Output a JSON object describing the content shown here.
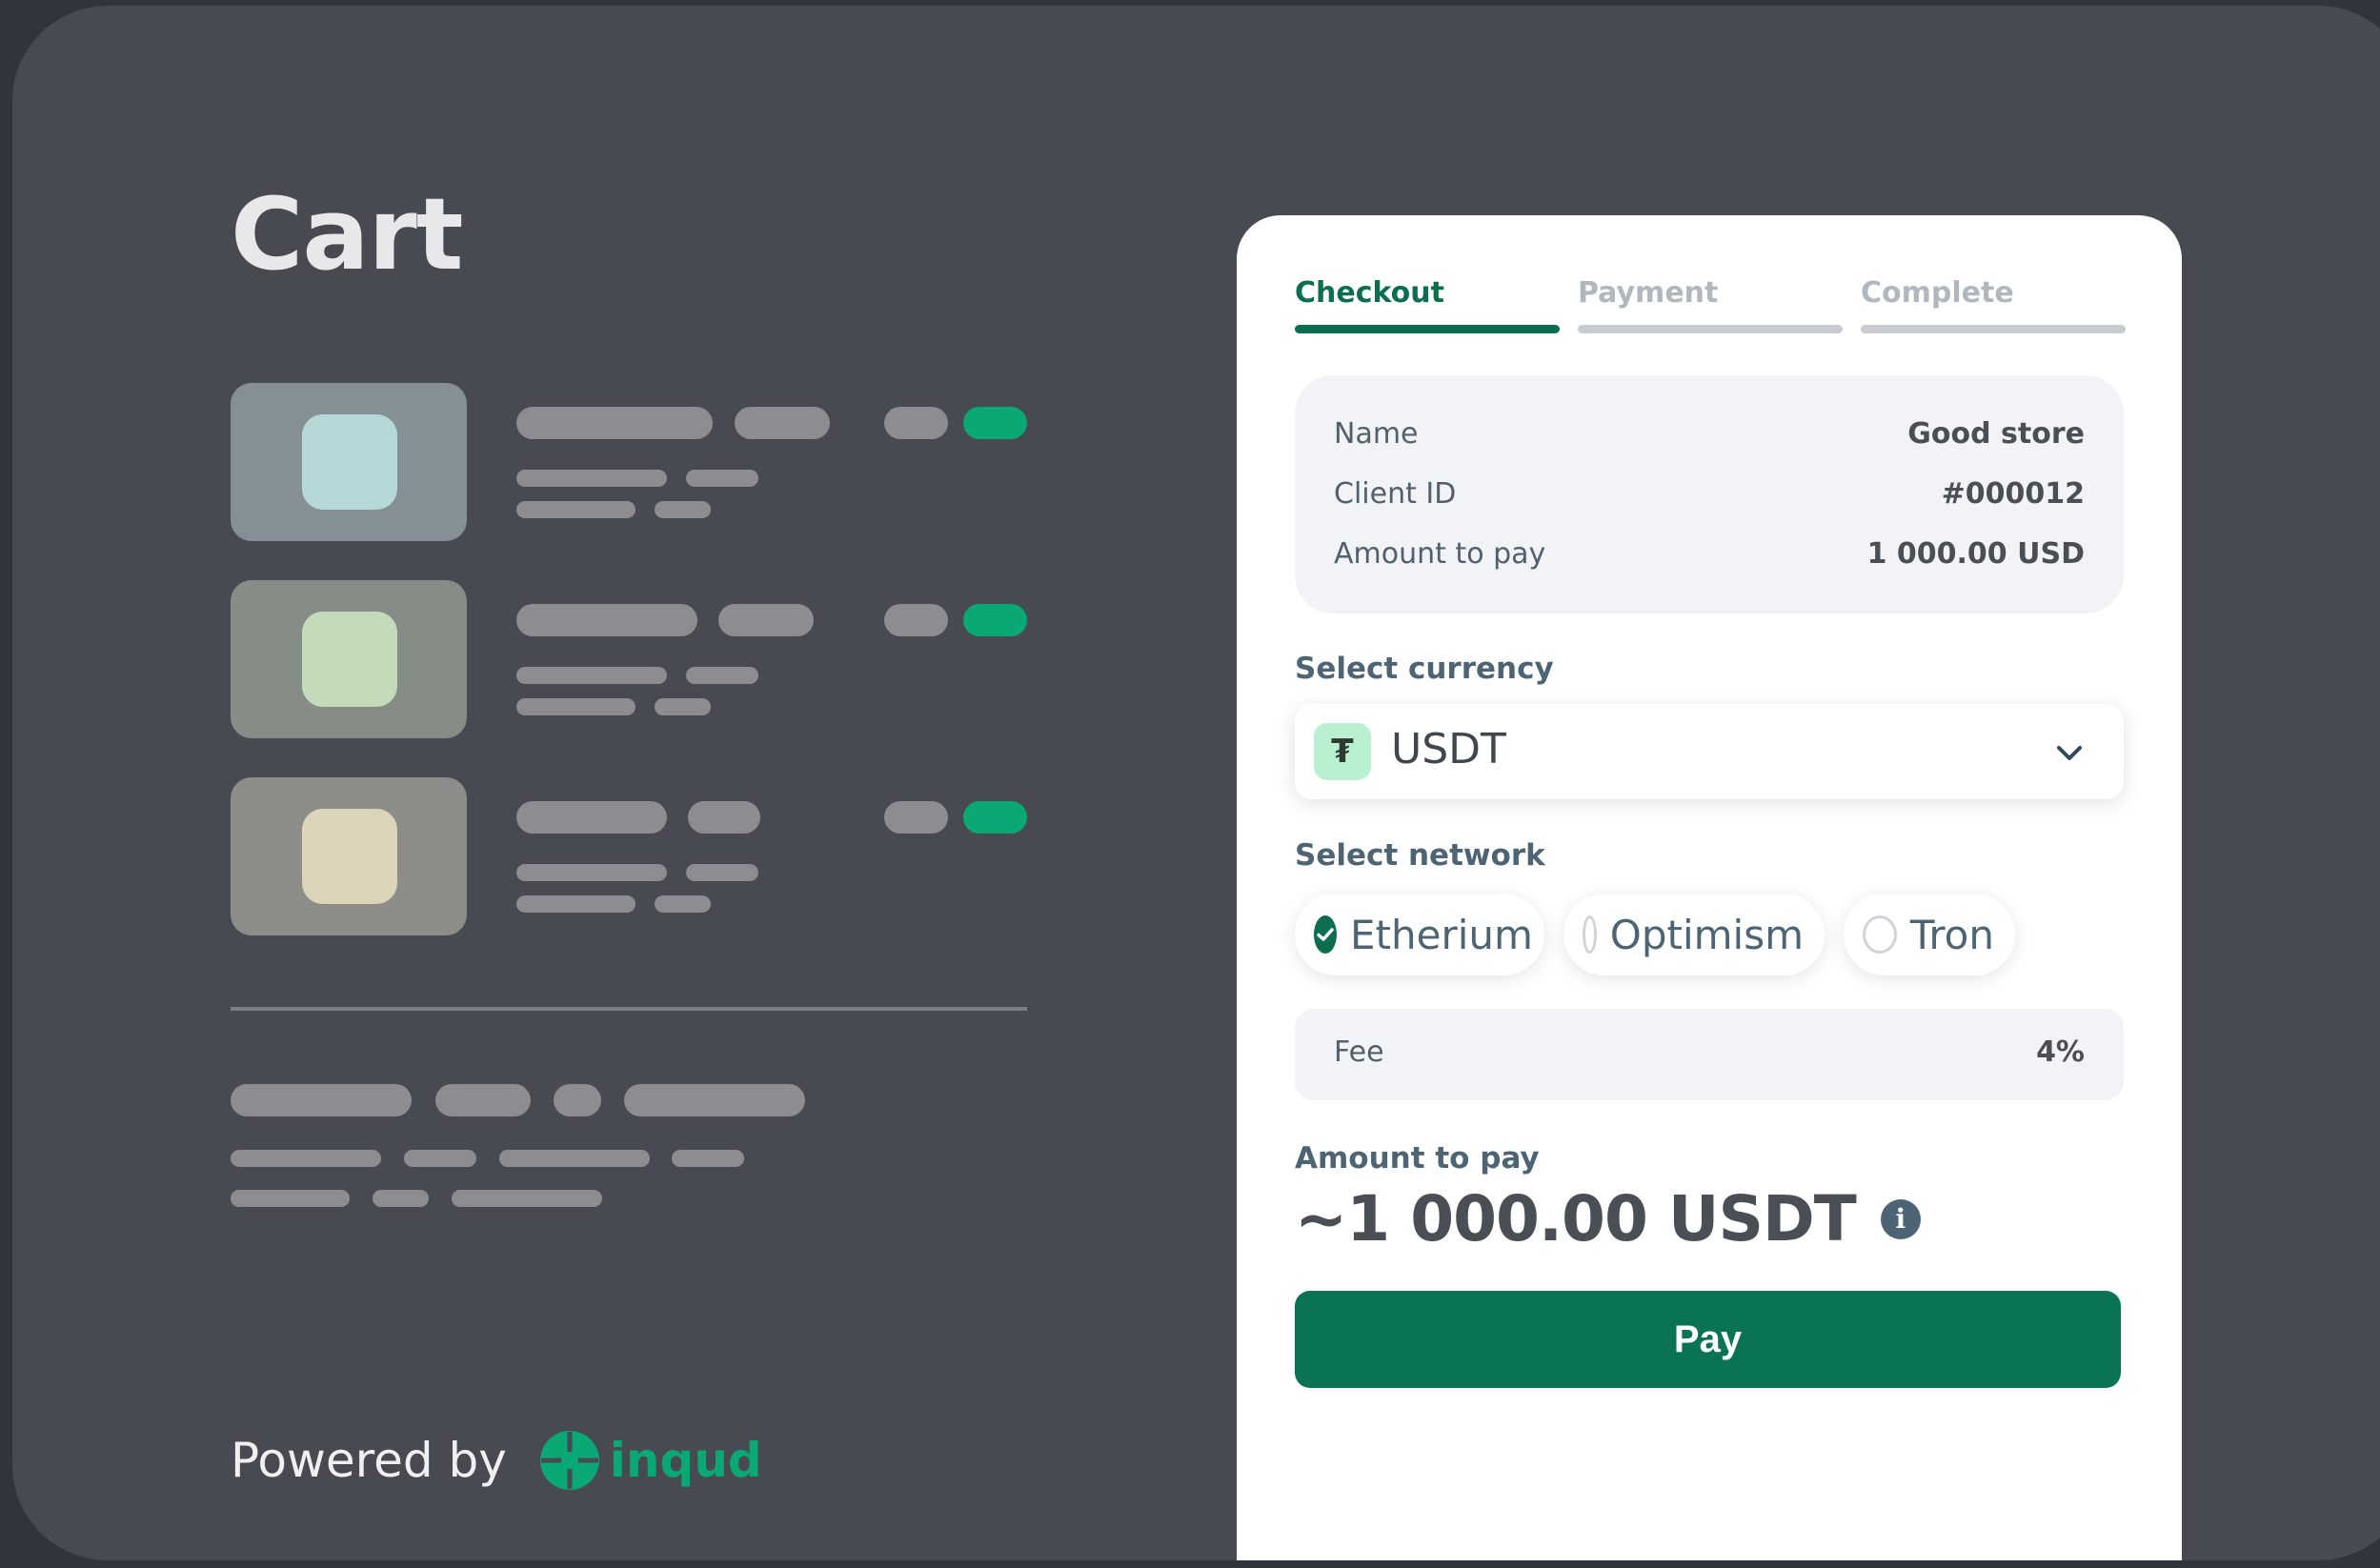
{
  "cart": {
    "title": "Cart",
    "thumb_colors": [
      "#849096",
      "#868d87",
      "#8c8d88"
    ],
    "thumb_inner_colors": [
      "#b7d8d9",
      "#c3dbbb",
      "#dcd4b8"
    ]
  },
  "footer": {
    "powered_by": "Powered by",
    "brand": "inqud"
  },
  "steps": [
    {
      "label": "Checkout",
      "active": true
    },
    {
      "label": "Payment",
      "active": false
    },
    {
      "label": "Complete",
      "active": false
    }
  ],
  "summary": {
    "rows": [
      {
        "label": "Name",
        "value": "Good store"
      },
      {
        "label": "Client ID",
        "value": "#000012"
      },
      {
        "label": "Amount to pay",
        "value": "1 000.00 USD"
      }
    ]
  },
  "currency": {
    "section_label": "Select currency",
    "icon": "tether-icon",
    "icon_glyph": "₮",
    "selected": "USDT"
  },
  "network": {
    "section_label": "Select network",
    "options": [
      {
        "label": "Etherium",
        "selected": true
      },
      {
        "label": "Optimism",
        "selected": false
      },
      {
        "label": "Tron",
        "selected": false
      }
    ]
  },
  "fee": {
    "label": "Fee",
    "value": "4%"
  },
  "amount": {
    "label": "Amount to pay",
    "value": "~1 000.00 USDT",
    "info_glyph": "i"
  },
  "pay_button": {
    "label": "Pay"
  },
  "colors": {
    "accent": "#0c6e4f",
    "accent_bright": "#0aa874",
    "background": "#474b51"
  }
}
